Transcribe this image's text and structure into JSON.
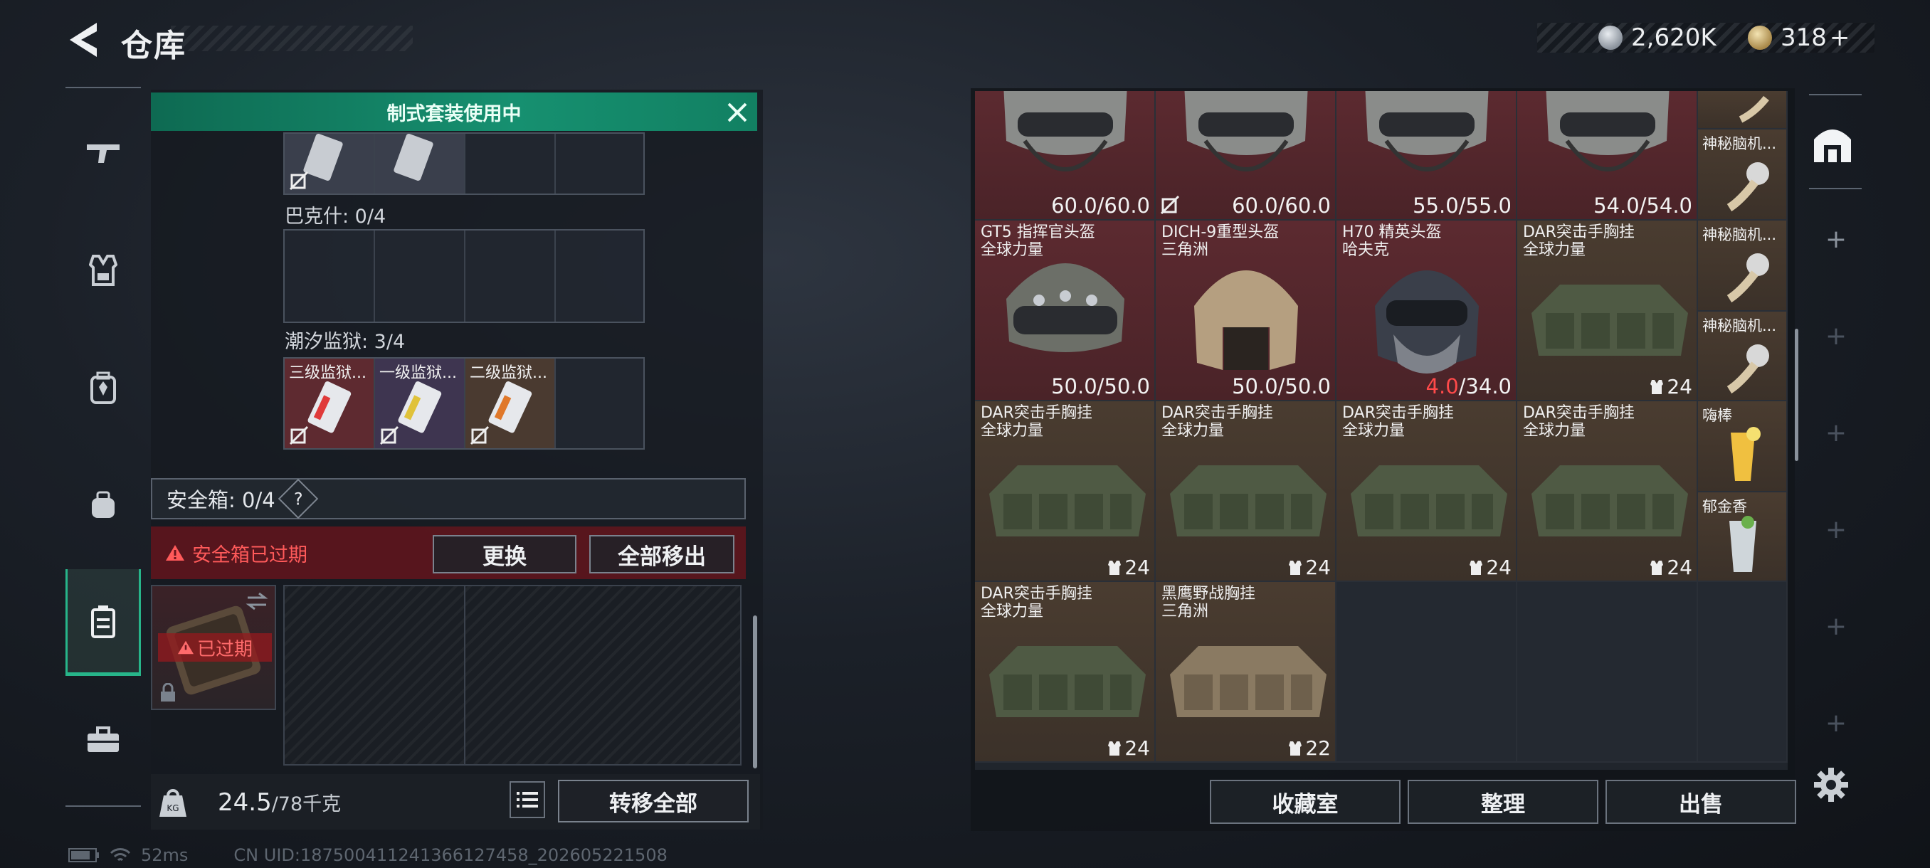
{
  "header": {
    "title": "仓库",
    "back_icon": "back-arrow-icon"
  },
  "currency": [
    {
      "icon": "silver-coin-icon",
      "value": "2,620K"
    },
    {
      "icon": "gold-coin-icon",
      "value": "318",
      "plus": "+"
    }
  ],
  "nav": [
    {
      "name": "weapon",
      "icon": "rifle-icon"
    },
    {
      "name": "armor",
      "icon": "vest-icon"
    },
    {
      "name": "backpack",
      "icon": "backpack-icon"
    },
    {
      "name": "pouch",
      "icon": "pouch-icon"
    },
    {
      "name": "case",
      "icon": "case-icon",
      "active": true
    },
    {
      "name": "toolbox",
      "icon": "toolbox-icon"
    }
  ],
  "banner": {
    "text": "制式套装使用中"
  },
  "keys_top": {
    "items": [
      {
        "name": ""
      },
      {
        "name": ""
      }
    ]
  },
  "section_bakshi": {
    "label": "巴克什: 0/4"
  },
  "section_prison": {
    "label": "潮汐监狱: 3/4",
    "items": [
      {
        "name": "三级监狱...",
        "color": "#5e2a30"
      },
      {
        "name": "一级监狱...",
        "color": "#3e3550"
      },
      {
        "name": "二级监狱...",
        "color": "#4a3a30"
      }
    ]
  },
  "safe_case": {
    "label": "安全箱: 0/4",
    "help": "?",
    "warning": "安全箱已过期",
    "replace_button": "更换",
    "move_all_button": "全部移出",
    "expired_badge": "已过期"
  },
  "bottom_left": {
    "weight": "24.5",
    "weight_max": "/78千克",
    "transfer_all": "转移全部"
  },
  "status": {
    "ping": "52ms",
    "uid": "CN UID:18750041124136612​7458_202605221508"
  },
  "stash": {
    "row1": [
      {
        "dur": "60.0/60.0"
      },
      {
        "dur": "60.0/60.0",
        "locked": true
      },
      {
        "dur": "55.0/55.0"
      },
      {
        "dur": "54.0/54.0"
      }
    ],
    "row2": [
      {
        "name": "GT5 指挥官头盔",
        "origin": "全球力量",
        "dur": "50.0/50.0"
      },
      {
        "name": "DICH-9重型头盔",
        "origin": "三角洲",
        "dur": "50.0/50.0"
      },
      {
        "name": "H70 精英头盔",
        "origin": "哈夫克",
        "dur_low": "4.0",
        "dur_max": "/34.0"
      },
      {
        "name": "DAR突击手胸挂",
        "origin": "全球力量",
        "count": "24"
      }
    ],
    "row3": [
      {
        "name": "DAR突击手胸挂",
        "origin": "全球力量",
        "count": "24"
      },
      {
        "name": "DAR突击手胸挂",
        "origin": "全球力量",
        "count": "24"
      },
      {
        "name": "DAR突击手胸挂",
        "origin": "全球力量",
        "count": "24"
      },
      {
        "name": "DAR突击手胸挂",
        "origin": "全球力量",
        "count": "24"
      }
    ],
    "row4": [
      {
        "name": "DAR突击手胸挂",
        "origin": "全球力量",
        "count": "24"
      },
      {
        "name": "黑鹰野战胸挂",
        "origin": "三角洲",
        "count": "22"
      }
    ],
    "side": [
      {
        "name": ""
      },
      {
        "name": "神秘脑机..."
      },
      {
        "name": "神秘脑机..."
      },
      {
        "name": "神秘脑机..."
      },
      {
        "name": "嗨棒"
      },
      {
        "name": "郁金香"
      }
    ]
  },
  "right_buttons": {
    "vault": "收藏室",
    "sort": "整理",
    "sell": "出售"
  },
  "colors": {
    "accent": "#27b58a",
    "danger": "#ff4a4a",
    "banner": "#138a68"
  }
}
